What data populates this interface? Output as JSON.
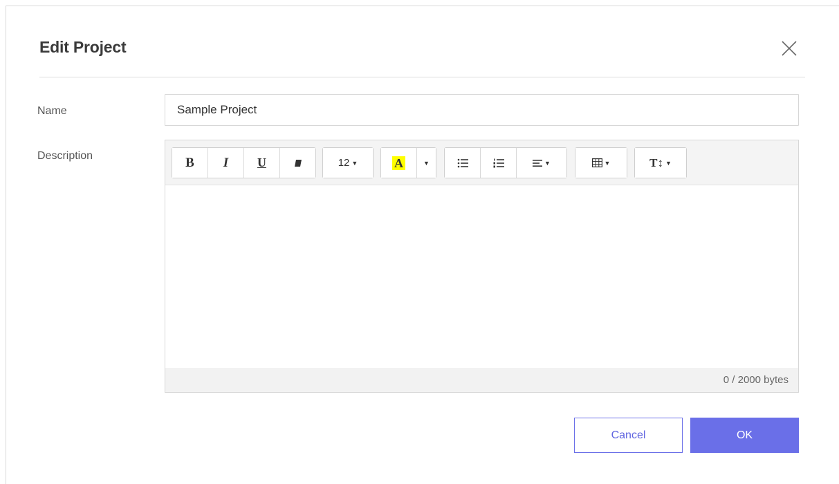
{
  "dialog": {
    "title": "Edit Project",
    "close_icon": "close-icon"
  },
  "form": {
    "name_label": "Name",
    "name_value": "Sample Project",
    "description_label": "Description"
  },
  "toolbar": {
    "bold": "B",
    "italic": "I",
    "underline": "U",
    "eraser_icon": "eraser-icon",
    "font_size": "12",
    "highlight": "A",
    "highlight_color": "#ffff00",
    "unordered_list_icon": "unordered-list-icon",
    "ordered_list_icon": "ordered-list-icon",
    "align_icon": "align-left-icon",
    "table_icon": "table-icon",
    "text_height": "T↕"
  },
  "editor": {
    "content": "",
    "byte_count": "0 / 2000 bytes"
  },
  "actions": {
    "cancel_label": "Cancel",
    "ok_label": "OK"
  },
  "colors": {
    "primary": "#6a6fe8",
    "border": "#d7d7d7",
    "toolbar_bg": "#f4f4f4"
  }
}
